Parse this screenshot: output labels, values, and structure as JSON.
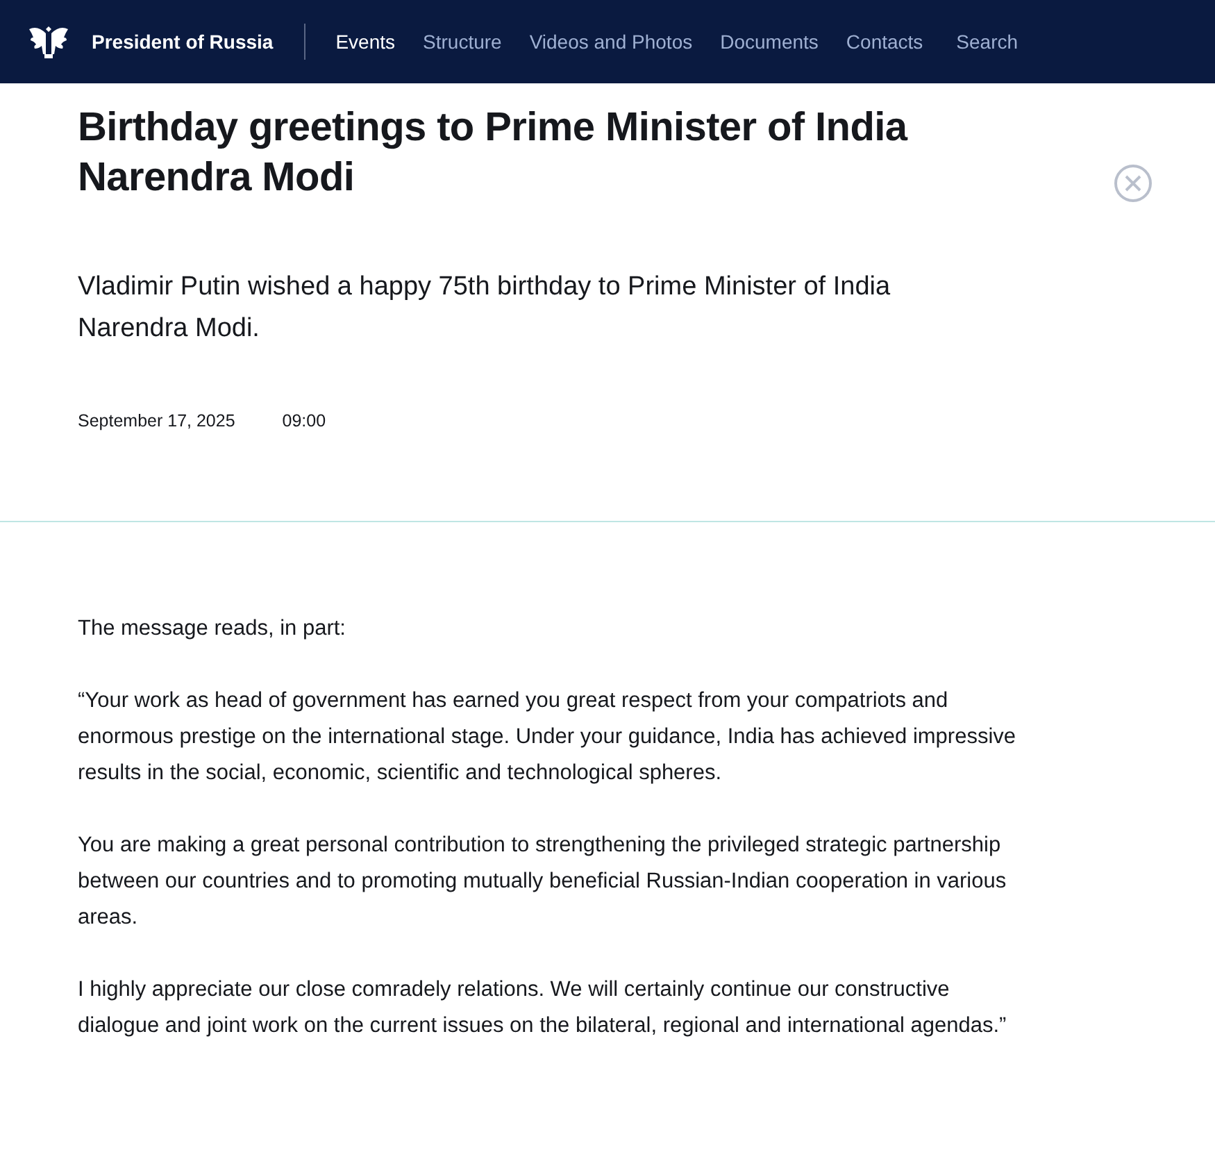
{
  "header": {
    "site_title": "President of Russia",
    "nav": [
      {
        "label": "Events",
        "selected": true
      },
      {
        "label": "Structure",
        "selected": false
      },
      {
        "label": "Videos and Photos",
        "selected": false
      },
      {
        "label": "Documents",
        "selected": false
      },
      {
        "label": "Contacts",
        "selected": false
      }
    ],
    "search": "Search"
  },
  "article": {
    "title": "Birthday greetings to Prime Minister of India Narendra Modi",
    "lead": "Vladimir Putin wished a happy 75th birthday to Prime Minister of India Narendra Modi.",
    "date": "September 17, 2025",
    "time": "09:00",
    "paragraphs": [
      "The message reads, in part:",
      "“Your work as head of government has earned you great respect from your compatriots and enormous prestige on the international stage. Under your guidance, India has achieved impressive results in the social, economic, scientific and technological spheres.",
      "You are making a great personal contribution to strengthening the privileged strategic partnership between our countries and to promoting mutually beneficial Russian-Indian cooperation in various areas.",
      "I highly appreciate our close comradely relations. We will certainly continue our constructive dialogue and joint work on the current issues on the bilateral, regional and international agendas.”"
    ]
  }
}
